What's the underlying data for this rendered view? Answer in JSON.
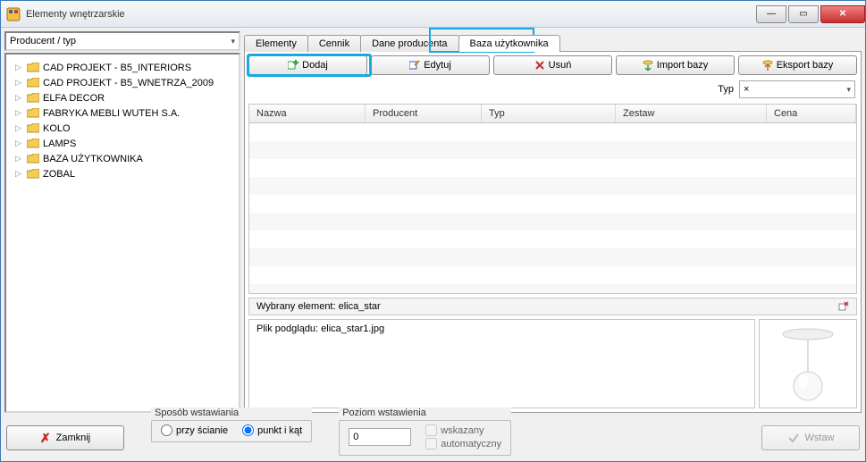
{
  "window": {
    "title": "Elementy wnętrzarskie"
  },
  "left": {
    "combo": "Producent / typ",
    "tree": [
      "CAD PROJEKT - B5_INTERIORS",
      "CAD PROJEKT - B5_WNETRZA_2009",
      "ELFA DECOR",
      "FABRYKA MEBLI WUTEH S.A.",
      "KOLO",
      "LAMPS",
      "BAZA UŻYTKOWNIKA",
      "ZOBAL"
    ]
  },
  "tabs": [
    "Elementy",
    "Cennik",
    "Dane producenta",
    "Baza użytkownika"
  ],
  "toolbar": {
    "add": "Dodaj",
    "edit": "Edytuj",
    "delete": "Usuń",
    "import": "Import bazy",
    "export": "Eksport bazy"
  },
  "filter": {
    "label": "Typ",
    "value": "×"
  },
  "table": {
    "cols": [
      "Nazwa",
      "Producent",
      "Typ",
      "Zestaw",
      "Cena"
    ]
  },
  "selected": {
    "label": "Wybrany element: elica_star",
    "preview_label": "Plik podglądu: elica_star1.jpg"
  },
  "bottom": {
    "close": "Zamknij",
    "mode_title": "Sposób wstawiania",
    "mode_wall": "przy ścianie",
    "mode_point": "punkt i kąt",
    "level_title": "Poziom wstawienia",
    "level_value": "0",
    "chk_pointed": "wskazany",
    "chk_auto": "automatyczny",
    "insert": "Wstaw"
  }
}
